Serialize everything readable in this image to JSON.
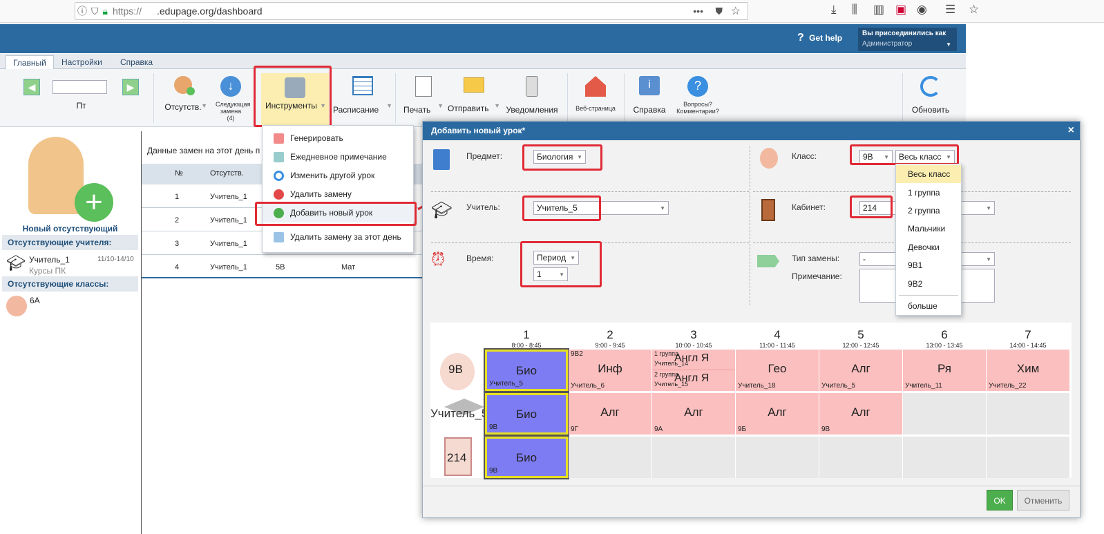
{
  "browser": {
    "url_prefix": "https://",
    "url_domain": ".edupage.org/dashboard",
    "more": "•••"
  },
  "header": {
    "help": "Get help",
    "user_line1": "Вы присоединились как",
    "user_line2": "Администратор"
  },
  "tabs": [
    "Главный",
    "Настройки",
    "Справка"
  ],
  "toolbar": {
    "day": "Пт",
    "absent": "Отсутств.",
    "next_sub": "Следующая замена",
    "next_sub_count": "(4)",
    "tools": "Инструменты",
    "schedule": "Расписание",
    "print": "Печать",
    "send": "Отправить",
    "notify": "Уведомления",
    "web": "Веб-страница",
    "help": "Справка",
    "questions": "Вопросы? Комментарии?",
    "refresh": "Обновить"
  },
  "sidebar": {
    "new_absent": "Новый отсутствующий",
    "absent_teachers": "Отсутствующие учителя:",
    "teacher_name": "Учитель_1",
    "teacher_dates": "11/10-14/10",
    "teacher_note": "Курсы ПК",
    "absent_classes": "Отсутствующие классы:",
    "class_name": "6A"
  },
  "main": {
    "caption": "Данные замен на этот день п",
    "col_num": "№",
    "col_absent": "Отсутств.",
    "rows": [
      {
        "num": "1",
        "teacher": "Учитель_1",
        "cls": "",
        "subj": ""
      },
      {
        "num": "2",
        "teacher": "Учитель_1",
        "cls": "",
        "subj": ""
      },
      {
        "num": "3",
        "teacher": "Учитель_1",
        "cls": "",
        "subj": ""
      },
      {
        "num": "4",
        "teacher": "Учитель_1",
        "cls": "5B",
        "subj": "Мат"
      }
    ]
  },
  "tools_menu": [
    "Генерировать",
    "Ежедневное примечание",
    "Изменить другой урок",
    "Удалить замену",
    "Добавить новый урок",
    "Удалить замену за этот день"
  ],
  "dialog": {
    "title": "Добавить новый урок*",
    "subject_label": "Предмет:",
    "subject_value": "Биология",
    "teacher_label": "Учитель:",
    "teacher_value": "Учитель_5",
    "time_label": "Время:",
    "time_mode": "Период",
    "time_period": "1",
    "class_label": "Класс:",
    "class_value": "9B",
    "group_value": "Весь класс",
    "room_label": "Кабинет:",
    "room_value": "214",
    "subtype_label": "Тип замены:",
    "subtype_value": "-",
    "note_label": "Примечание:",
    "ok": "OK",
    "cancel": "Отменить"
  },
  "group_dropdown": [
    "Весь класс",
    "1 группа",
    "2 группа",
    "Мальчики",
    "Девочки",
    "9B1",
    "9B2",
    "больше"
  ],
  "grid": {
    "row_labels": [
      "9B",
      "Учитель_5",
      "214"
    ],
    "periods": [
      {
        "n": "1",
        "t": "8:00 - 8:45"
      },
      {
        "n": "2",
        "t": "9:00 - 9:45"
      },
      {
        "n": "3",
        "t": "10:00 - 10:45"
      },
      {
        "n": "4",
        "t": "11:00 - 11:45"
      },
      {
        "n": "5",
        "t": "12:00 - 12:45"
      },
      {
        "n": "6",
        "t": "13:00 - 13:45"
      },
      {
        "n": "7",
        "t": "14:00 - 14:45"
      }
    ],
    "class_row": [
      {
        "subj": "Био",
        "teacher": "Учитель_5",
        "cls": ""
      },
      {
        "subj": "Инф",
        "teacher": "Учитель_6",
        "cls": "9B2"
      },
      {
        "subj": "",
        "teacher": "",
        "cls": ""
      },
      {
        "subj": "Гео",
        "teacher": "Учитель_18",
        "cls": ""
      },
      {
        "subj": "Алг",
        "teacher": "Учитель_5",
        "cls": ""
      },
      {
        "subj": "Ря",
        "teacher": "Учитель_11",
        "cls": ""
      },
      {
        "subj": "Хим",
        "teacher": "Учитель_22",
        "cls": ""
      }
    ],
    "split": {
      "g1": "1 группа",
      "t1": "Учитель_14",
      "s1": "Англ Я",
      "g2": "2 группа",
      "t2": "Учитель_15",
      "s2": "Англ Я"
    },
    "teacher_row": [
      {
        "subj": "Био",
        "cls": "9B"
      },
      {
        "subj": "Алг",
        "cls": "9Г"
      },
      {
        "subj": "Алг",
        "cls": "9A"
      },
      {
        "subj": "Алг",
        "cls": "9Б"
      },
      {
        "subj": "Алг",
        "cls": "9B"
      }
    ],
    "room_row": [
      {
        "subj": "Био",
        "cls": "9B"
      }
    ]
  }
}
